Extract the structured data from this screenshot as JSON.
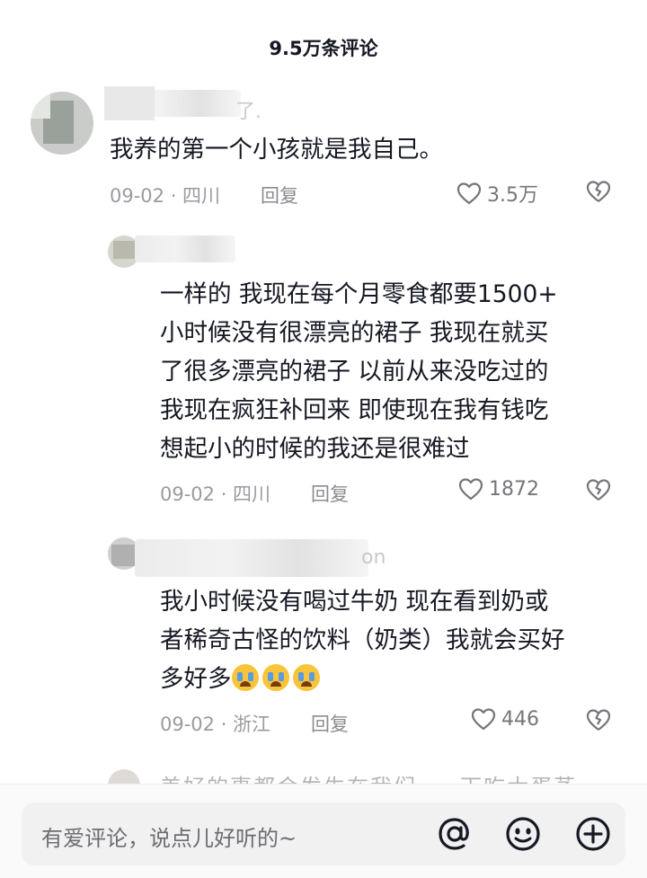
{
  "header": {
    "title": "9.5万条评论"
  },
  "comments": [
    {
      "name_tail": "了.",
      "text_lines": [
        "我养的第一个小孩就是我自己。"
      ],
      "meta": "09-02 · 四川",
      "reply": "回复",
      "likes": "3.5万"
    },
    {
      "text_lines": [
        "一样的  我现在每个月零食都要1500+",
        "小时候没有很漂亮的裙子  我现在就买",
        "了很多漂亮的裙子   以前从来没吃过的",
        "我现在疯狂补回来   即使现在我有钱吃",
        "想起小的时候的我还是很难过"
      ],
      "meta": "09-02 · 四川",
      "reply": "回复",
      "likes": "1872"
    },
    {
      "name_tail": "on",
      "text_lines": [
        "我小时候没有喝过牛奶 现在看到奶或",
        "者稀奇古怪的饮料（奶类）我就会买好"
      ],
      "text_last": "多好多",
      "emoji_name": "crying-face-emoji",
      "meta": "09-02 · 浙江",
      "reply": "回复",
      "likes": "446"
    }
  ],
  "peek_comment": {
    "text": "美好的事都会发生在我们 ·  ·  下吃大蛋蒸"
  },
  "bottom_bar": {
    "placeholder": "有爱评论，说点儿好听的~",
    "icons": [
      "at-icon",
      "emoji-icon",
      "add-icon"
    ]
  },
  "colors": {
    "text": "#161823",
    "meta": "#9a9ba0",
    "background": "#ffffff"
  }
}
